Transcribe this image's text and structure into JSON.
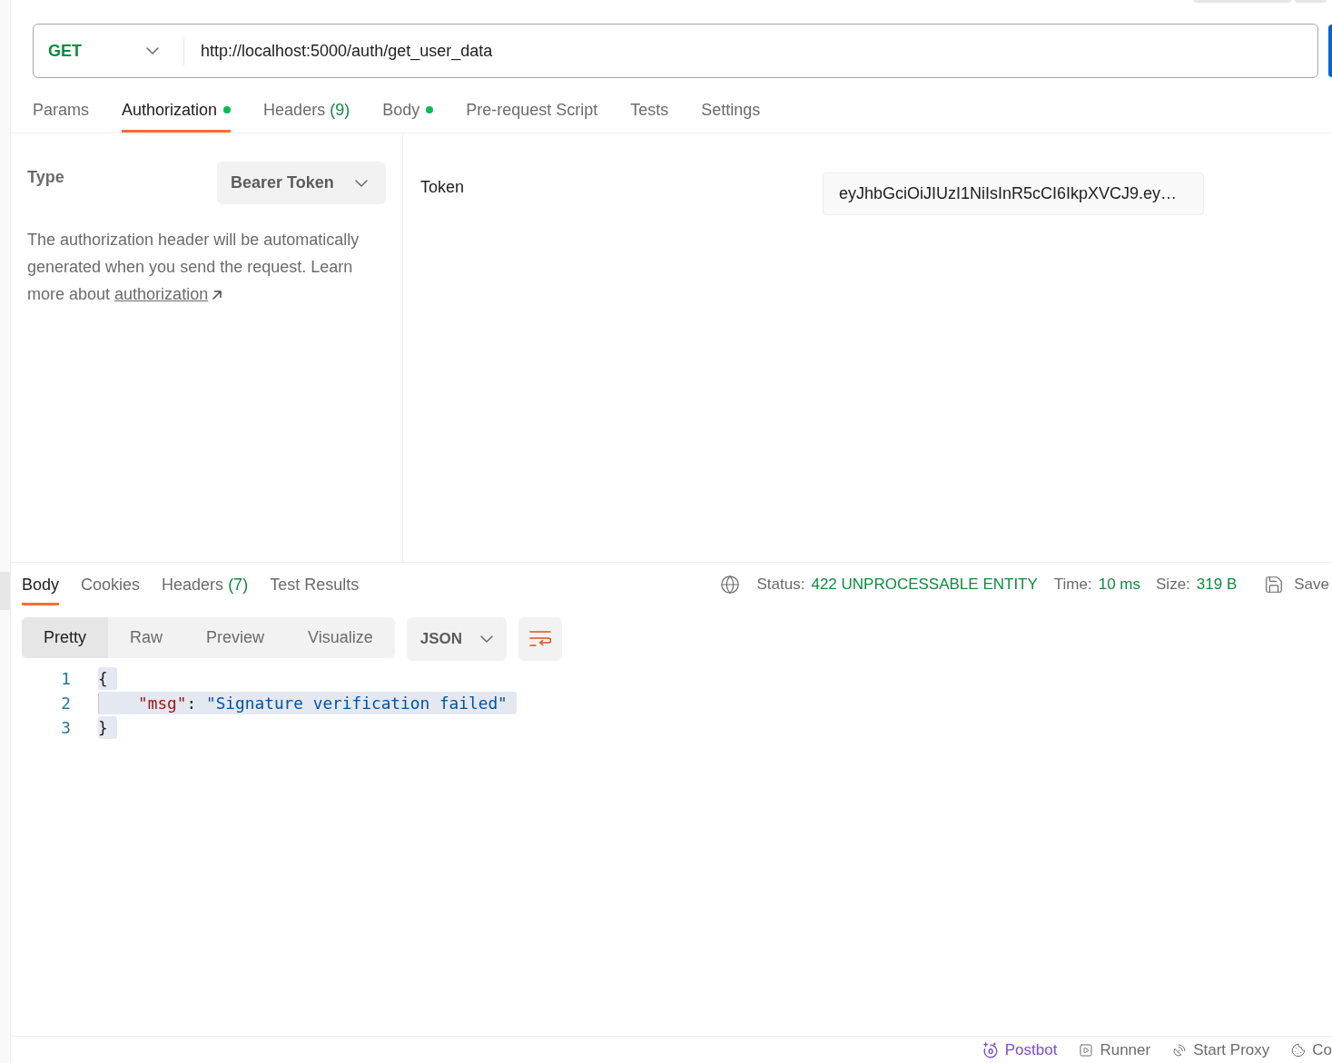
{
  "request": {
    "method": "GET",
    "url": "http://localhost:5000/auth/get_user_data"
  },
  "request_tabs": [
    {
      "label": "Params",
      "selected": false,
      "dot": false
    },
    {
      "label": "Authorization",
      "selected": true,
      "dot": true
    },
    {
      "label": "Headers",
      "count": "(9)",
      "selected": false,
      "dot": false
    },
    {
      "label": "Body",
      "selected": false,
      "dot": true
    },
    {
      "label": "Pre-request Script",
      "selected": false,
      "dot": false
    },
    {
      "label": "Tests",
      "selected": false,
      "dot": false
    },
    {
      "label": "Settings",
      "selected": false,
      "dot": false
    }
  ],
  "auth": {
    "type_label": "Type",
    "type_value": "Bearer Token",
    "description": "The authorization header will be automatically generated when you send the request. Learn more about",
    "link": "authorization",
    "token_label": "Token",
    "token_value": "eyJhbGciOiJIUzI1NiIsInR5cCI6IkpXVCJ9.ey…"
  },
  "response": {
    "tabs": [
      {
        "label": "Body",
        "selected": true
      },
      {
        "label": "Cookies",
        "selected": false
      },
      {
        "label": "Headers",
        "count": "(7)",
        "selected": false
      },
      {
        "label": "Test Results",
        "selected": false
      }
    ],
    "status_label": "Status:",
    "status": "422 UNPROCESSABLE ENTITY",
    "time_label": "Time:",
    "time": "10 ms",
    "size_label": "Size:",
    "size": "319 B",
    "save": "Save",
    "view_modes": [
      {
        "label": "Pretty",
        "selected": true
      },
      {
        "label": "Raw",
        "selected": false
      },
      {
        "label": "Preview",
        "selected": false
      },
      {
        "label": "Visualize",
        "selected": false
      }
    ],
    "format": "JSON",
    "code_lines": [
      {
        "number": "1",
        "indented": false,
        "highlighted": true,
        "tokens": [
          {
            "kind": "punct",
            "text": "{"
          }
        ]
      },
      {
        "number": "2",
        "indented": true,
        "highlighted": true,
        "tokens": [
          {
            "kind": "key",
            "text": "\"msg\""
          },
          {
            "kind": "punct",
            "text": ": "
          },
          {
            "kind": "string",
            "text": "\"Signature verification failed\""
          }
        ]
      },
      {
        "number": "3",
        "indented": false,
        "highlighted": true,
        "tokens": [
          {
            "kind": "punct",
            "text": "}"
          }
        ]
      }
    ]
  },
  "status_bar": [
    {
      "kind": "postbot",
      "label": "Postbot"
    },
    {
      "kind": "runner",
      "label": "Runner"
    },
    {
      "kind": "proxy",
      "label": "Start Proxy"
    },
    {
      "kind": "cookies",
      "label": "Co"
    }
  ]
}
